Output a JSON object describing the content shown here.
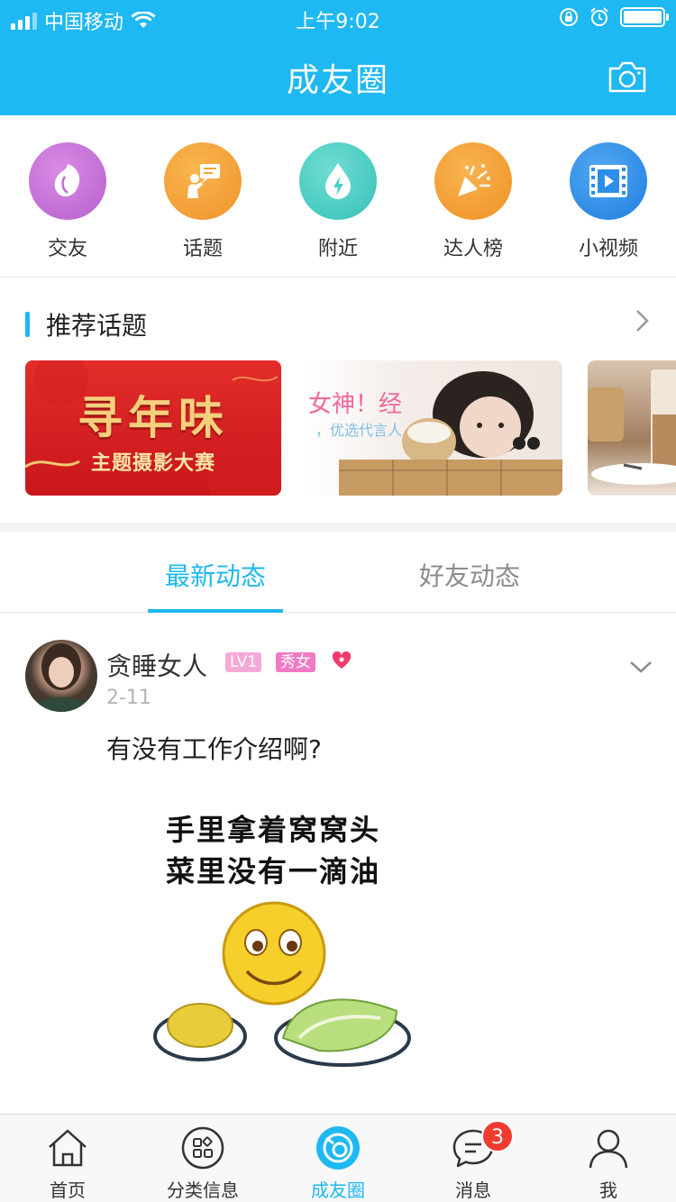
{
  "status_bar": {
    "carrier": "中国移动",
    "time": "上午9:02"
  },
  "header": {
    "title": "成友圈"
  },
  "quick_entries": [
    {
      "label": "交友",
      "icon": "petal-icon",
      "color": "#c06bd6"
    },
    {
      "label": "话题",
      "icon": "speaker-topic-icon",
      "color": "#f4a233"
    },
    {
      "label": "附近",
      "icon": "water-drop-icon",
      "color": "#45cfc4"
    },
    {
      "label": "达人榜",
      "icon": "party-popper-icon",
      "color": "#f59f2e"
    },
    {
      "label": "小视频",
      "icon": "film-play-icon",
      "color": "#2c8ee8"
    }
  ],
  "topics": {
    "title": "推荐话题",
    "banners": [
      {
        "title": "寻年味",
        "subtitle": "主题摄影大赛"
      },
      {
        "title": "女神！经",
        "subtitle": "，优选代言人"
      }
    ]
  },
  "feed_tabs": {
    "latest": "最新动态",
    "friends": "好友动态",
    "active": "latest"
  },
  "post": {
    "username": "贪睡女人",
    "level": "LV1",
    "gender_badge": "秀女",
    "date": "2-11",
    "text": "有没有工作介绍啊?",
    "image_caption_line1": "手里拿着窝窝头",
    "image_caption_line2": "菜里没有一滴油"
  },
  "tabbar": {
    "items": [
      {
        "label": "首页",
        "icon": "home-icon"
      },
      {
        "label": "分类信息",
        "icon": "category-grid-icon"
      },
      {
        "label": "成友圈",
        "icon": "circle-camera-icon",
        "active": true
      },
      {
        "label": "消息",
        "icon": "chat-bubble-icon",
        "badge": "3"
      },
      {
        "label": "我",
        "icon": "person-icon"
      }
    ]
  },
  "colors": {
    "brand": "#1eb8f2",
    "badge_red": "#f23b30"
  }
}
